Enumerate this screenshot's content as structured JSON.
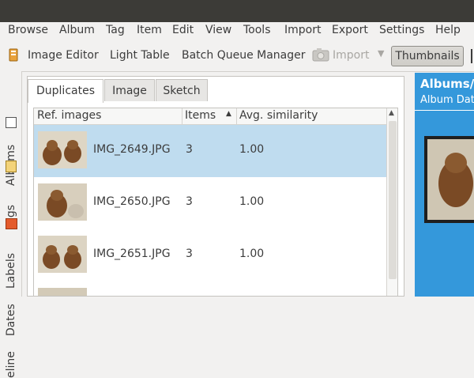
{
  "menu": [
    "Browse",
    "Album",
    "Tag",
    "Item",
    "Edit",
    "View",
    "Tools",
    "Import",
    "Export",
    "Settings",
    "Help"
  ],
  "toolbar": {
    "image_editor": "Image Editor",
    "light_table": "Light Table",
    "batch_queue": "Batch Queue Manager",
    "import": "Import",
    "thumbnails": "Thumbnails"
  },
  "sidebar": {
    "albums": "Albums",
    "tags": "Tags",
    "labels": "Labels",
    "dates": "Dates",
    "timeline": "eline"
  },
  "tabs": [
    "Duplicates",
    "Image",
    "Sketch"
  ],
  "table": {
    "headers": [
      "Ref. images",
      "Items",
      "Avg. similarity"
    ],
    "rows": [
      {
        "name": "IMG_2649.JPG",
        "items": "3",
        "similarity": "1.00"
      },
      {
        "name": "IMG_2650.JPG",
        "items": "3",
        "similarity": "1.00"
      },
      {
        "name": "IMG_2651.JPG",
        "items": "3",
        "similarity": "1.00"
      }
    ]
  },
  "right_panel": {
    "title": "Albums/",
    "subtitle": "Album Dat"
  },
  "colors": {
    "accent": "#3498db",
    "selection": "#bfdcef",
    "titlebar": "#3c3b37"
  }
}
